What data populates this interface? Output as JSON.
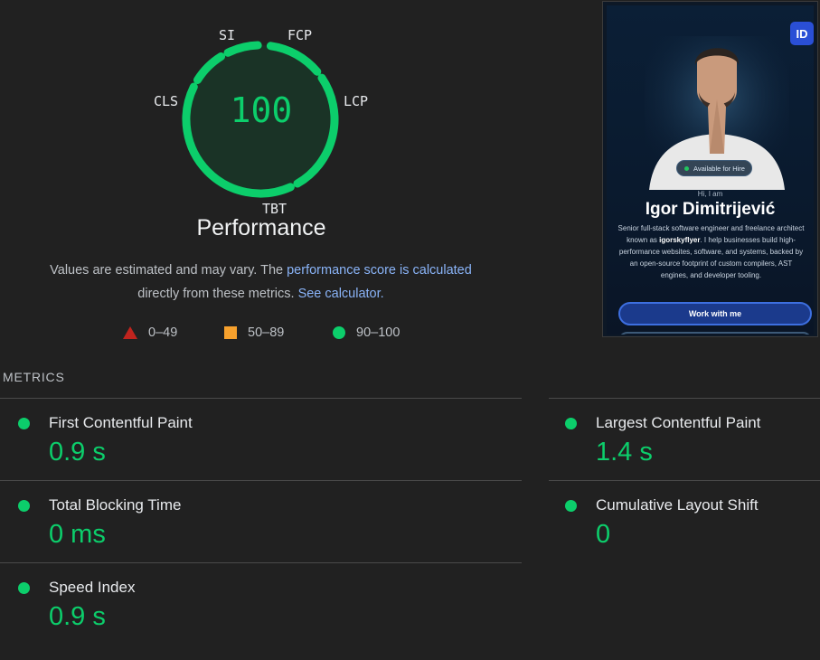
{
  "gauge": {
    "score": "100",
    "title": "Performance",
    "labels": {
      "si": "SI",
      "fcp": "FCP",
      "lcp": "LCP",
      "tbt": "TBT",
      "cls": "CLS"
    },
    "score_value": 100,
    "colors": {
      "pass": "#0cce6b",
      "fill": "#1a3326"
    }
  },
  "description": {
    "text1": "Values are estimated and may vary. The ",
    "link1": "performance score is calculated",
    "text2": "directly from these metrics. ",
    "link2": "See calculator."
  },
  "legend": {
    "fail": "0–49",
    "average": "50–89",
    "pass": "90–100",
    "colors": {
      "fail": "#c0241e",
      "average": "#f7a12d",
      "pass": "#0cce6b"
    }
  },
  "thumbnail": {
    "logo": "ID",
    "badge": "Available for Hire",
    "greeting": "Hi, I am",
    "name": "Igor Dimitrijević",
    "bio_part1": "Senior full-stack software engineer and freelance architect known as ",
    "bio_handle": "igorskyflyer",
    "bio_part2": ". I help businesses build high-performance websites, software, and systems, backed by an open-source footprint of custom compilers, AST engines, and developer tooling.",
    "cta": "Work with me"
  },
  "metrics": {
    "title": "METRICS",
    "items": [
      {
        "label": "First Contentful Paint",
        "value": "0.9 s"
      },
      {
        "label": "Largest Contentful Paint",
        "value": "1.4 s"
      },
      {
        "label": "Total Blocking Time",
        "value": "0 ms"
      },
      {
        "label": "Cumulative Layout Shift",
        "value": "0"
      },
      {
        "label": "Speed Index",
        "value": "0.9 s"
      }
    ]
  }
}
